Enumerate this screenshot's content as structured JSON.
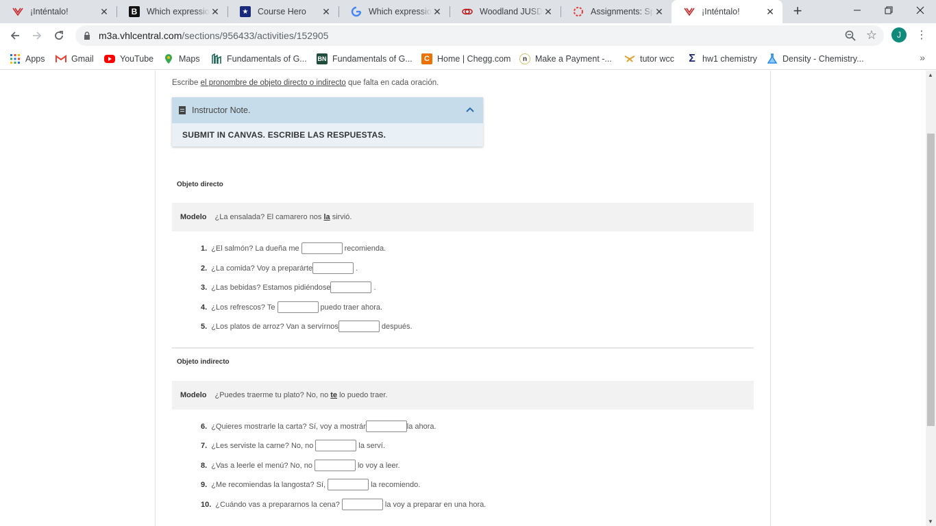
{
  "tabs": [
    {
      "title": "¡Inténtalo!",
      "icon": "vhl-icon",
      "active": false
    },
    {
      "title": "Which expression m",
      "icon": "b-icon",
      "active": false
    },
    {
      "title": "Course Hero",
      "icon": "coursehero-icon",
      "active": false
    },
    {
      "title": "Which expression m",
      "icon": "google-icon",
      "active": false
    },
    {
      "title": "Woodland JUSD Stu",
      "icon": "woodland-icon",
      "active": false
    },
    {
      "title": "Assignments: Spani",
      "icon": "canvas-icon",
      "active": false
    },
    {
      "title": "¡Inténtalo!",
      "icon": "vhl-icon",
      "active": true
    }
  ],
  "address_bar": {
    "domain": "m3a.vhlcentral.com",
    "path": "/sections/956433/activities/152905"
  },
  "profile_initial": "J",
  "bookmarks": [
    {
      "label": "Apps",
      "icon": "apps-grid-icon"
    },
    {
      "label": "Gmail",
      "icon": "gmail-icon"
    },
    {
      "label": "YouTube",
      "icon": "youtube-icon"
    },
    {
      "label": "Maps",
      "icon": "maps-icon"
    },
    {
      "label": "Fundamentals of G...",
      "icon": "building-icon"
    },
    {
      "label": "Fundamentals of G...",
      "icon": "bn-icon"
    },
    {
      "label": "Home | Chegg.com",
      "icon": "chegg-icon"
    },
    {
      "label": "Make a Payment -...",
      "icon": "n-icon"
    },
    {
      "label": "tutor wcc",
      "icon": "tutor-icon"
    },
    {
      "label": "hw1 chemistry",
      "icon": "sigma-icon"
    },
    {
      "label": "Density - Chemistry...",
      "icon": "flask-icon"
    }
  ],
  "instructions": {
    "before": "Escribe ",
    "link": "el pronombre de objeto directo o indirecto",
    "after": " que falta en cada oración."
  },
  "instructor_note": {
    "title": "Instructor Note.",
    "body": "SUBMIT IN CANVAS. ESCRIBE LAS RESPUESTAS."
  },
  "section_direct": {
    "label": "Objeto directo",
    "modelo_label": "Modelo",
    "modelo_before": "¿La ensalada? El camarero nos ",
    "modelo_bold": "la",
    "modelo_after": " sirvió."
  },
  "direct_items": [
    {
      "num": "1.",
      "before": "¿El salmón? La dueña me",
      "after": "recomienda.",
      "value": ""
    },
    {
      "num": "2.",
      "before": "¿La comida? Voy a preparárte",
      "after": ".",
      "value": ""
    },
    {
      "num": "3.",
      "before": "¿Las bebidas? Estamos pidiéndose",
      "after": ".",
      "value": ""
    },
    {
      "num": "4.",
      "before": "¿Los refrescos? Te",
      "after": "puedo traer ahora.",
      "value": ""
    },
    {
      "num": "5.",
      "before": "¿Los platos de arroz? Van a servírnos",
      "after": "después.",
      "value": ""
    }
  ],
  "section_indirect": {
    "label": "Objeto indirecto",
    "modelo_label": "Modelo",
    "modelo_before": "¿Puedes traerme tu plato? No, no ",
    "modelo_bold": "te",
    "modelo_after": " lo puedo traer."
  },
  "indirect_items": [
    {
      "num": "6.",
      "before": "¿Quieres mostrarle la carta? Sí, voy a mostrár",
      "after": "la ahora.",
      "value": ""
    },
    {
      "num": "7.",
      "before": "¿Les serviste la carne? No, no",
      "after": "la serví.",
      "value": ""
    },
    {
      "num": "8.",
      "before": "¿Vas a leerle el menú? No, no",
      "after": "lo voy a leer.",
      "value": ""
    },
    {
      "num": "9.",
      "before": "¿Me recomiendas la langosta? Sí,",
      "after": "la recomiendo.",
      "value": ""
    },
    {
      "num": "10.",
      "before": "¿Cuándo vas a prepararnos la cena?",
      "after": "la voy a preparar en una hora.",
      "value": ""
    }
  ]
}
